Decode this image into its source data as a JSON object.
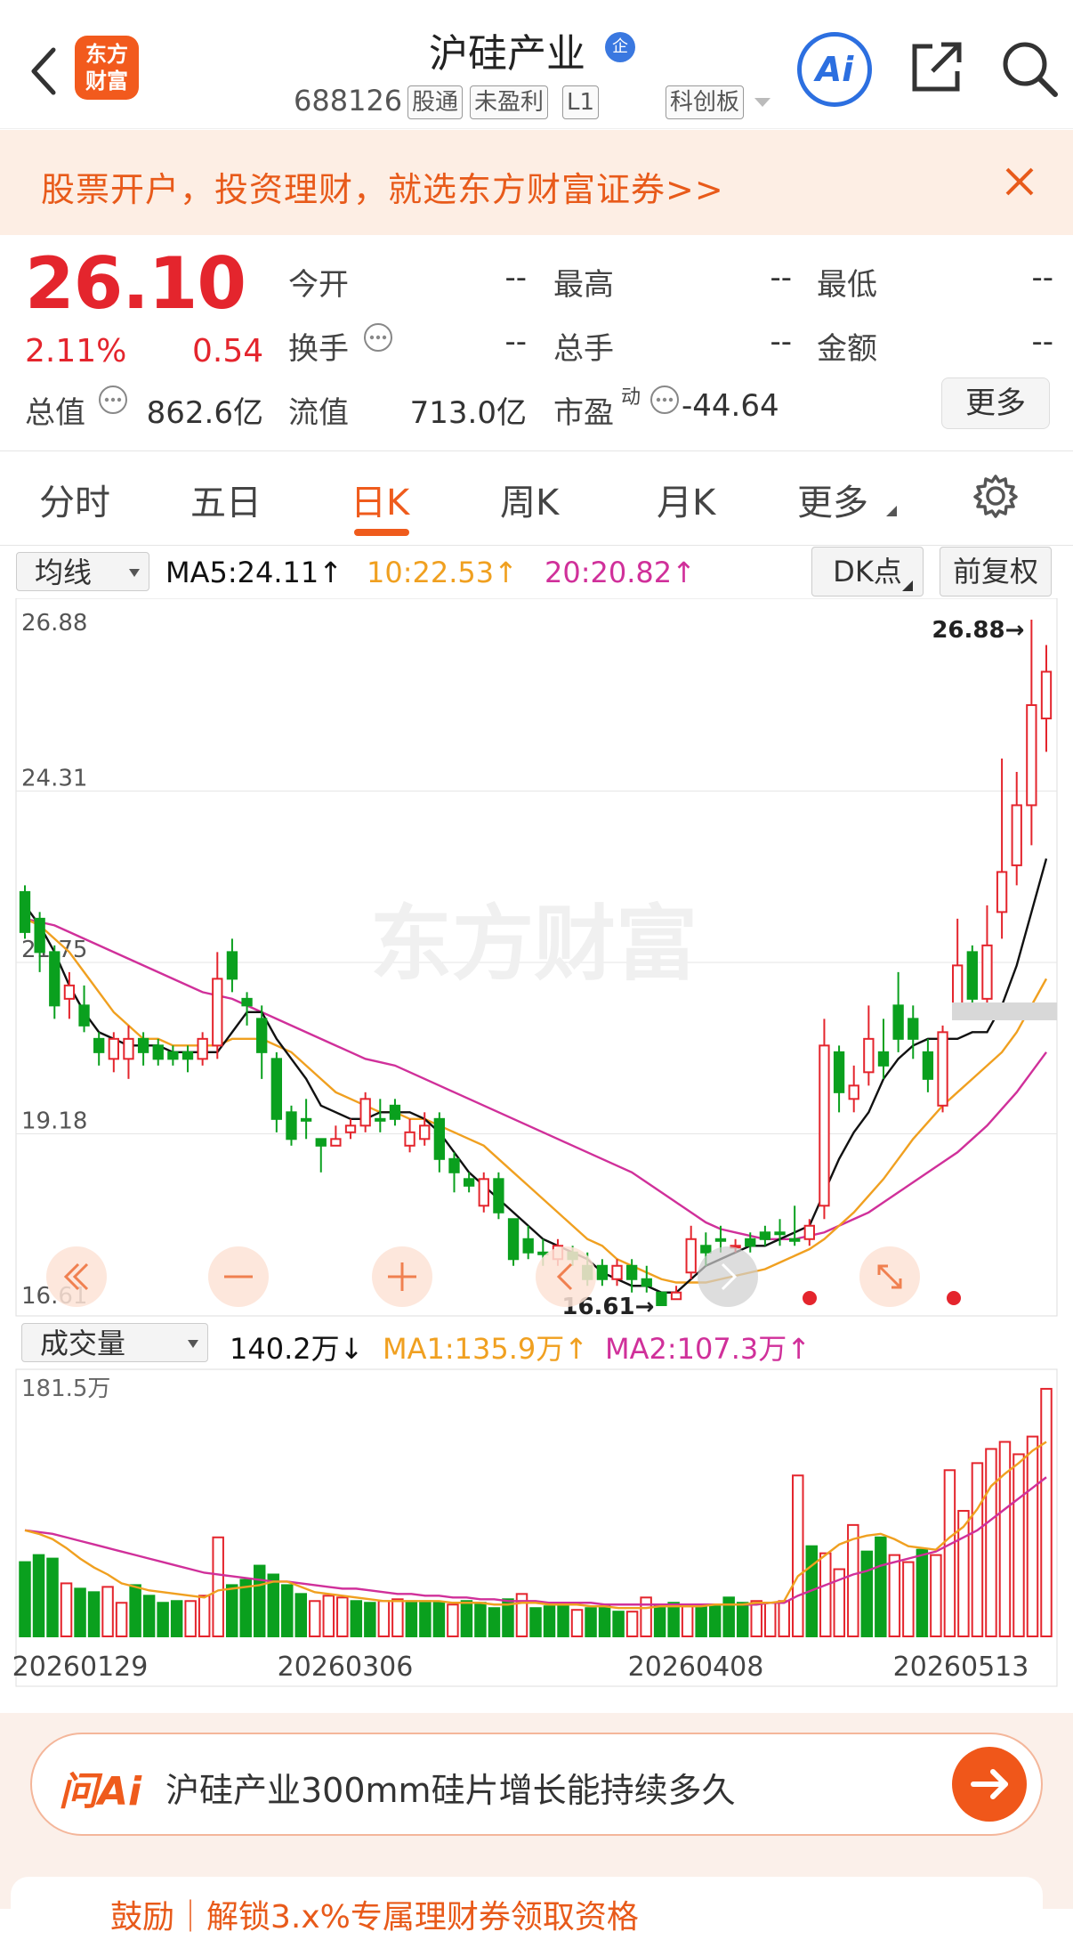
{
  "header": {
    "title": "沪硅产业",
    "title_badge": "企",
    "logo_lines": [
      "东方",
      "财富"
    ],
    "code": "688126",
    "tags": [
      "股通",
      "未盈利",
      "L1"
    ],
    "board": "科创板",
    "ai_label": "Ai"
  },
  "banner": {
    "text": "股票开户，投资理财，就选东方财富证券>>"
  },
  "quote": {
    "price": "26.10",
    "change_pct": "2.11%",
    "change": "0.54",
    "open_label": "今开",
    "open_val": "--",
    "high_label": "最高",
    "high_val": "--",
    "low_label": "最低",
    "low_val": "--",
    "turnover_label": "换手",
    "turnover_val": "--",
    "volume_label": "总手",
    "volume_val": "--",
    "amount_label": "金额",
    "amount_val": "--",
    "mktcap_label": "总值",
    "mktcap_val": "862.6亿",
    "float_label": "流值",
    "float_val": "713.0亿",
    "pe_label": "市盈",
    "pe_sup": "动",
    "pe_val": "-44.64",
    "more_button": "更多"
  },
  "tabs": [
    "分时",
    "五日",
    "日K",
    "周K",
    "月K",
    "更多"
  ],
  "active_tab": "日K",
  "chart_controls": {
    "indicator_select": "均线",
    "ma5": "MA5:24.11↑",
    "ma10": "10:22.53↑",
    "ma20": "20:20.82↑",
    "dk_button": "DK点",
    "adjust_button": "前复权",
    "volume_select": "成交量",
    "vol_value": "140.2万↓",
    "vol_ma1": "MA1:135.9万↑",
    "vol_ma2": "MA2:107.3万↑"
  },
  "colors": {
    "up": "#e4252d",
    "down": "#0aa01e",
    "ma5": "#111111",
    "ma10": "#f0a020",
    "ma20": "#d0309a",
    "accent": "#ef5b1c"
  },
  "chart_data": {
    "type": "candlestick",
    "ylim": [
      16.61,
      26.88
    ],
    "y_ticks": [
      "26.88",
      "24.31",
      "21.75",
      "19.18",
      "16.61"
    ],
    "high_label": "26.88→",
    "low_label": "16.61→",
    "x_ticks": [
      "20260129",
      "20260306",
      "20260408",
      "20260513"
    ],
    "volume_max_label": "181.5万",
    "candles": [
      [
        22.2,
        22.9,
        22.8,
        22.1,
        "d"
      ],
      [
        22.4,
        22.5,
        21.9,
        21.6,
        "d"
      ],
      [
        21.9,
        22.0,
        21.1,
        20.9,
        "d"
      ],
      [
        21.2,
        21.6,
        21.4,
        20.9,
        "u"
      ],
      [
        21.1,
        21.4,
        20.8,
        20.7,
        "d"
      ],
      [
        20.6,
        20.7,
        20.4,
        20.2,
        "d"
      ],
      [
        20.3,
        20.7,
        20.6,
        20.1,
        "u"
      ],
      [
        20.3,
        20.8,
        20.6,
        20.0,
        "u"
      ],
      [
        20.6,
        20.7,
        20.4,
        20.2,
        "d"
      ],
      [
        20.5,
        20.6,
        20.3,
        20.2,
        "d"
      ],
      [
        20.4,
        20.5,
        20.3,
        20.2,
        "d"
      ],
      [
        20.4,
        20.5,
        20.3,
        20.1,
        "d"
      ],
      [
        20.3,
        20.7,
        20.6,
        20.2,
        "u"
      ],
      [
        20.5,
        21.9,
        21.5,
        20.3,
        "u"
      ],
      [
        21.9,
        22.1,
        21.5,
        21.3,
        "d"
      ],
      [
        21.2,
        21.3,
        21.1,
        20.8,
        "d"
      ],
      [
        20.9,
        21.1,
        20.4,
        20.0,
        "d"
      ],
      [
        20.3,
        20.4,
        19.4,
        19.2,
        "d"
      ],
      [
        19.5,
        19.6,
        19.1,
        19.0,
        "d"
      ],
      [
        19.4,
        19.7,
        19.4,
        19.1,
        "d"
      ],
      [
        19.1,
        19.1,
        19.0,
        18.6,
        "d"
      ],
      [
        19.1,
        19.3,
        19.0,
        19.0,
        "u"
      ],
      [
        19.2,
        19.4,
        19.3,
        19.1,
        "u"
      ],
      [
        19.3,
        19.8,
        19.7,
        19.2,
        "u"
      ],
      [
        19.4,
        19.7,
        19.4,
        19.2,
        "d"
      ],
      [
        19.6,
        19.7,
        19.4,
        19.3,
        "d"
      ],
      [
        19.0,
        19.4,
        19.2,
        18.9,
        "u"
      ],
      [
        19.1,
        19.5,
        19.3,
        19.0,
        "u"
      ],
      [
        19.4,
        19.5,
        18.8,
        18.6,
        "d"
      ],
      [
        18.8,
        18.9,
        18.6,
        18.3,
        "d"
      ],
      [
        18.5,
        18.6,
        18.4,
        18.3,
        "d"
      ],
      [
        18.1,
        18.6,
        18.5,
        18.0,
        "u"
      ],
      [
        18.5,
        18.6,
        18.0,
        17.9,
        "d"
      ],
      [
        17.9,
        17.9,
        17.3,
        17.2,
        "d"
      ],
      [
        17.6,
        17.8,
        17.4,
        17.3,
        "d"
      ],
      [
        17.4,
        17.6,
        17.4,
        17.2,
        "d"
      ],
      [
        17.3,
        17.6,
        17.5,
        17.2,
        "u"
      ],
      [
        17.4,
        17.5,
        17.3,
        17.2,
        "d"
      ],
      [
        17.2,
        17.4,
        17.0,
        16.9,
        "d"
      ],
      [
        17.2,
        17.3,
        17.0,
        16.9,
        "d"
      ],
      [
        17.0,
        17.3,
        17.2,
        16.9,
        "u"
      ],
      [
        17.2,
        17.3,
        17.0,
        16.8,
        "d"
      ],
      [
        16.9,
        17.2,
        17.0,
        16.8,
        "d"
      ],
      [
        16.8,
        16.8,
        16.61,
        16.61,
        "d"
      ],
      [
        16.7,
        16.9,
        16.8,
        16.7,
        "u"
      ],
      [
        17.1,
        17.8,
        17.6,
        17.0,
        "u"
      ],
      [
        17.5,
        17.7,
        17.4,
        17.2,
        "d"
      ],
      [
        17.6,
        17.8,
        17.6,
        17.4,
        "d"
      ],
      [
        17.5,
        17.6,
        17.5,
        17.4,
        "u"
      ],
      [
        17.5,
        17.7,
        17.6,
        17.4,
        "d"
      ],
      [
        17.6,
        17.8,
        17.7,
        17.5,
        "d"
      ],
      [
        17.7,
        17.9,
        17.7,
        17.5,
        "d"
      ],
      [
        17.6,
        18.1,
        17.6,
        17.5,
        "d"
      ],
      [
        17.6,
        17.9,
        17.8,
        17.5,
        "u"
      ],
      [
        18.1,
        20.9,
        20.5,
        17.9,
        "u"
      ],
      [
        20.4,
        20.5,
        19.8,
        19.5,
        "d"
      ],
      [
        19.7,
        20.2,
        19.9,
        19.5,
        "u"
      ],
      [
        20.1,
        21.1,
        20.6,
        19.9,
        "u"
      ],
      [
        20.2,
        20.9,
        20.4,
        20.0,
        "d"
      ],
      [
        20.6,
        21.6,
        21.1,
        20.4,
        "d"
      ],
      [
        20.9,
        21.1,
        20.6,
        20.3,
        "d"
      ],
      [
        20.4,
        20.6,
        20.0,
        19.8,
        "d"
      ],
      [
        19.6,
        20.8,
        20.7,
        19.5,
        "u"
      ],
      [
        21.0,
        22.4,
        21.7,
        20.9,
        "u"
      ],
      [
        21.9,
        22.0,
        21.2,
        20.9,
        "d"
      ],
      [
        21.2,
        22.6,
        22.0,
        21.0,
        "u"
      ],
      [
        22.5,
        24.8,
        23.1,
        22.1,
        "u"
      ],
      [
        23.2,
        24.6,
        24.1,
        22.9,
        "u"
      ],
      [
        24.1,
        26.88,
        25.6,
        23.5,
        "u"
      ],
      [
        25.4,
        26.5,
        26.1,
        24.9,
        "u"
      ]
    ],
    "ma5": [
      22.6,
      22.3,
      21.9,
      21.4,
      21.0,
      20.7,
      20.6,
      20.5,
      20.5,
      20.5,
      20.4,
      20.4,
      20.4,
      20.4,
      20.7,
      21.0,
      21.0,
      20.6,
      20.3,
      20.0,
      19.6,
      19.5,
      19.4,
      19.4,
      19.5,
      19.5,
      19.5,
      19.4,
      19.2,
      18.9,
      18.6,
      18.4,
      18.2,
      18.0,
      17.8,
      17.6,
      17.5,
      17.4,
      17.3,
      17.1,
      17.0,
      16.9,
      16.9,
      16.8,
      16.8,
      17.0,
      17.2,
      17.3,
      17.4,
      17.5,
      17.5,
      17.6,
      17.7,
      17.8,
      18.3,
      18.8,
      19.2,
      19.5,
      20.0,
      20.3,
      20.5,
      20.6,
      20.6,
      20.6,
      20.7,
      20.7,
      21.1,
      21.7,
      22.5,
      23.3
    ],
    "ma10": [
      22.4,
      22.3,
      22.1,
      21.9,
      21.6,
      21.3,
      21.0,
      20.8,
      20.6,
      20.6,
      20.5,
      20.5,
      20.5,
      20.5,
      20.6,
      20.6,
      20.6,
      20.5,
      20.4,
      20.2,
      20.0,
      19.8,
      19.7,
      19.6,
      19.5,
      19.5,
      19.4,
      19.4,
      19.3,
      19.2,
      19.1,
      19.0,
      18.8,
      18.6,
      18.4,
      18.2,
      18.0,
      17.8,
      17.6,
      17.5,
      17.3,
      17.2,
      17.1,
      17.0,
      16.95,
      16.95,
      16.95,
      17.0,
      17.05,
      17.1,
      17.15,
      17.25,
      17.35,
      17.45,
      17.6,
      17.8,
      18.0,
      18.25,
      18.5,
      18.8,
      19.1,
      19.35,
      19.6,
      19.8,
      20.0,
      20.2,
      20.4,
      20.7,
      21.1,
      21.5
    ],
    "ma20": [
      22.4,
      22.35,
      22.3,
      22.2,
      22.1,
      22.0,
      21.9,
      21.8,
      21.7,
      21.6,
      21.5,
      21.4,
      21.3,
      21.25,
      21.2,
      21.1,
      21.0,
      20.9,
      20.8,
      20.7,
      20.6,
      20.5,
      20.4,
      20.3,
      20.25,
      20.2,
      20.1,
      20.0,
      19.9,
      19.8,
      19.7,
      19.6,
      19.5,
      19.4,
      19.3,
      19.2,
      19.1,
      19.0,
      18.9,
      18.8,
      18.7,
      18.6,
      18.45,
      18.3,
      18.15,
      18.0,
      17.85,
      17.75,
      17.7,
      17.65,
      17.6,
      17.6,
      17.6,
      17.65,
      17.7,
      17.8,
      17.9,
      18.0,
      18.15,
      18.3,
      18.45,
      18.6,
      18.75,
      18.9,
      19.1,
      19.3,
      19.55,
      19.8,
      20.1,
      20.4
    ],
    "volumes": [
      42,
      46,
      44,
      30,
      27,
      25,
      28,
      19,
      29,
      23,
      19,
      20,
      20,
      23,
      56,
      29,
      32,
      40,
      35,
      29,
      24,
      20,
      23,
      22,
      20,
      19,
      20,
      21,
      20,
      20,
      19,
      18,
      20,
      19,
      16,
      21,
      24,
      16,
      17,
      18,
      15,
      16,
      17,
      14,
      14,
      22,
      18,
      19,
      17,
      17,
      17,
      22,
      19,
      20,
      19,
      20,
      91,
      51,
      47,
      38,
      63,
      48,
      56,
      46,
      42,
      49,
      46,
      94,
      71,
      98,
      106,
      110,
      103,
      113,
      140
    ],
    "volume_up": [
      0,
      0,
      0,
      1,
      0,
      0,
      1,
      1,
      0,
      0,
      0,
      0,
      1,
      1,
      1,
      0,
      0,
      0,
      0,
      0,
      0,
      1,
      1,
      1,
      0,
      0,
      1,
      1,
      0,
      0,
      0,
      1,
      0,
      0,
      0,
      0,
      1,
      0,
      0,
      0,
      1,
      0,
      0,
      0,
      1,
      1,
      0,
      0,
      1,
      0,
      0,
      0,
      0,
      1,
      1,
      1,
      1,
      0,
      1,
      1,
      1,
      0,
      0,
      1,
      1,
      0,
      1,
      1,
      1,
      1,
      1,
      1,
      1,
      1,
      1
    ],
    "vol_ma1": [
      60,
      58,
      55,
      50,
      44,
      39,
      35,
      30,
      28,
      26,
      25,
      24,
      23,
      22,
      26,
      27,
      28,
      29,
      31,
      31,
      28,
      25,
      24,
      23,
      22,
      21,
      20,
      20,
      20,
      20,
      20,
      19,
      19,
      19,
      18,
      18,
      19,
      19,
      18,
      18,
      18,
      17,
      17,
      16,
      16,
      16,
      17,
      17,
      17,
      17,
      18,
      18,
      18,
      19,
      19,
      20,
      34,
      40,
      46,
      52,
      55,
      57,
      58,
      55,
      51,
      50,
      49,
      56,
      62,
      72,
      85,
      92,
      98,
      105,
      110
    ],
    "vol_ma2": [
      60,
      59,
      58,
      56,
      54,
      52,
      50,
      48,
      46,
      44,
      42,
      40,
      38,
      36,
      35,
      34,
      33,
      32,
      31,
      31,
      30,
      29,
      28,
      27,
      27,
      26,
      25,
      24,
      24,
      23,
      23,
      22,
      22,
      21,
      21,
      20,
      20,
      20,
      19,
      19,
      19,
      19,
      18,
      18,
      18,
      18,
      18,
      18,
      18,
      18,
      18,
      18,
      18,
      18,
      19,
      19,
      23,
      26,
      29,
      32,
      35,
      37,
      40,
      42,
      44,
      46,
      48,
      52,
      56,
      60,
      66,
      72,
      78,
      84,
      90
    ]
  },
  "chart_overlay": {
    "watermark": "东方财富"
  },
  "ai_bar": {
    "logo": "问Ai",
    "question": "沪硅产业300mm硅片增长能持续多久"
  },
  "promo": {
    "text": "鼓励｜解锁3.x%专属理财券领取资格"
  }
}
